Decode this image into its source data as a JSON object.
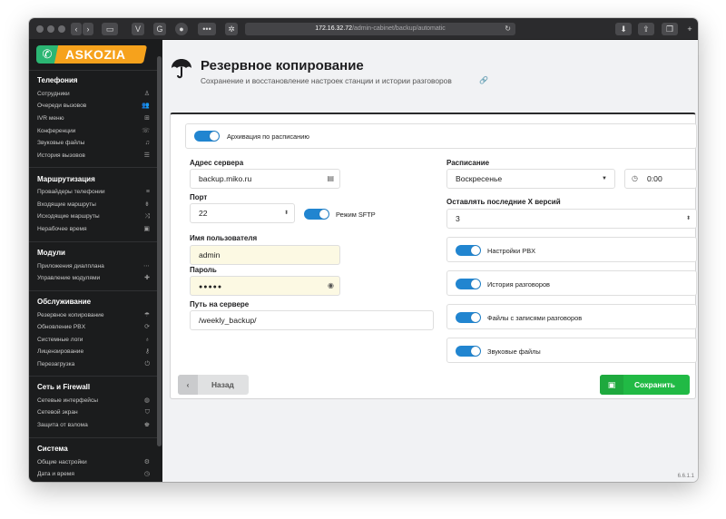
{
  "browser": {
    "url_host": "172.16.32.72",
    "url_path": "/admin-cabinet/backup/automatic"
  },
  "brand": {
    "logo_text": "ASKOZIA"
  },
  "sidebar": {
    "sections": [
      {
        "title": "Телефония",
        "items": [
          {
            "label": "Сотрудники",
            "icon": "user-icon"
          },
          {
            "label": "Очереди вызовов",
            "icon": "users-icon"
          },
          {
            "label": "IVR меню",
            "icon": "sitemap-icon"
          },
          {
            "label": "Конференции",
            "icon": "phone-volume-icon"
          },
          {
            "label": "Звуковые файлы",
            "icon": "headphones-icon"
          },
          {
            "label": "История вызовов",
            "icon": "list-icon"
          }
        ]
      },
      {
        "title": "Маршрутизация",
        "items": [
          {
            "label": "Провайдеры телефонии",
            "icon": "server-icon"
          },
          {
            "label": "Входящие маршруты",
            "icon": "incoming-icon"
          },
          {
            "label": "Исходящие маршруты",
            "icon": "shuffle-icon"
          },
          {
            "label": "Нерабочее время",
            "icon": "calendar-icon"
          }
        ]
      },
      {
        "title": "Модули",
        "items": [
          {
            "label": "Приложения диалплана",
            "icon": "code-icon"
          },
          {
            "label": "Управление модулями",
            "icon": "puzzle-icon"
          }
        ]
      },
      {
        "title": "Обслуживание",
        "items": [
          {
            "label": "Резервное копирование",
            "icon": "umbrella-icon"
          },
          {
            "label": "Обновление PBX",
            "icon": "sync-icon"
          },
          {
            "label": "Системные логи",
            "icon": "stethoscope-icon"
          },
          {
            "label": "Лицензирование",
            "icon": "key-icon"
          },
          {
            "label": "Перезагрузка",
            "icon": "power-icon"
          }
        ]
      },
      {
        "title": "Сеть и Firewall",
        "items": [
          {
            "label": "Сетевые интерфейсы",
            "icon": "globe-icon"
          },
          {
            "label": "Сетевой экран",
            "icon": "shield-icon"
          },
          {
            "label": "Защита от взлома",
            "icon": "user-secret-icon"
          }
        ]
      },
      {
        "title": "Система",
        "items": [
          {
            "label": "Общие настройки",
            "icon": "cogs-icon"
          },
          {
            "label": "Дата и время",
            "icon": "clock-icon"
          }
        ]
      }
    ]
  },
  "page": {
    "title": "Резервное копирование",
    "subtitle": "Сохранение и восстановление настроек станции и истории разговоров"
  },
  "form": {
    "schedule_toggle_label": "Архивация по расписанию",
    "server_label": "Адрес сервера",
    "server_value": "backup.miko.ru",
    "port_label": "Порт",
    "port_value": "22",
    "sftp_label": "Режим SFTP",
    "username_label": "Имя пользователя",
    "username_value": "admin",
    "password_label": "Пароль",
    "password_value": "●●●●●",
    "path_label": "Путь на сервере",
    "path_value": "/weekly_backup/",
    "schedule_label": "Расписание",
    "schedule_value": "Воскресенье",
    "time_value": "0:00",
    "keep_label": "Оставлять последние X версий",
    "keep_value": "3",
    "opt_pbx": "Настройки PBX",
    "opt_history": "История разговоров",
    "opt_records": "Файлы с записями разговоров",
    "opt_sounds": "Звуковые файлы"
  },
  "buttons": {
    "back": "Назад",
    "save": "Сохранить"
  },
  "footer": {
    "version": "6.6.1.1"
  }
}
